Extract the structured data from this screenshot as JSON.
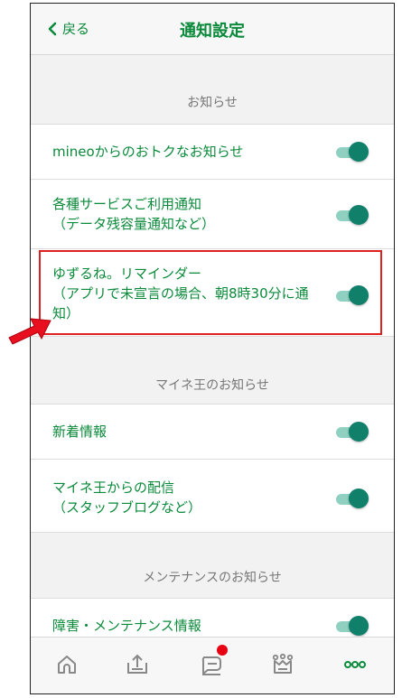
{
  "header": {
    "back_label": "戻る",
    "title": "通知設定"
  },
  "sections": [
    {
      "heading": "お知らせ",
      "items": [
        {
          "label": "mineoからのおトクなお知らせ",
          "enabled": true
        },
        {
          "label": "各種サービスご利用通知\n（データ残容量通知など）",
          "enabled": true
        },
        {
          "label": "ゆずるね。リマインダー\n（アプリで未宣言の場合、朝8時30分に通\n知）",
          "enabled": true
        }
      ]
    },
    {
      "heading": "マイネ王のお知らせ",
      "items": [
        {
          "label": "新着情報",
          "enabled": true
        },
        {
          "label": "マイネ王からの配信\n（スタッフブログなど）",
          "enabled": true
        }
      ]
    },
    {
      "heading": "メンテナンスのお知らせ",
      "items": [
        {
          "label": "障害・メンテナンス情報",
          "enabled": true
        }
      ]
    }
  ],
  "tabbar": {
    "tabs": [
      {
        "icon": "home-icon"
      },
      {
        "icon": "upload-tray-icon"
      },
      {
        "icon": "chat-icon",
        "badge": true
      },
      {
        "icon": "crown-icon"
      },
      {
        "icon": "more-icon"
      }
    ]
  },
  "colors": {
    "accent": "#0a8a3a",
    "toggle_on": "#11806b",
    "highlight": "#e02020",
    "badge": "#e60012"
  }
}
